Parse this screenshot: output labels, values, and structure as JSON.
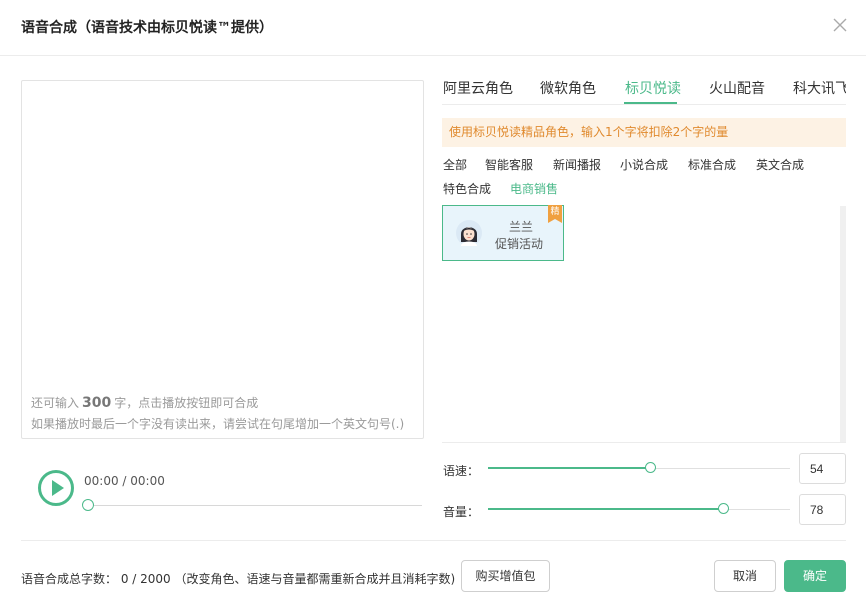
{
  "dialog": {
    "title": "语音合成（语音技术由标贝悦读™提供）",
    "close_icon": "close-icon"
  },
  "editor": {
    "remaining_prefix": "还可输入",
    "remaining_count": "300",
    "remaining_suffix": "字，点击播放按钮即可合成",
    "tip": "如果播放时最后一个字没有读出来，请尝试在句尾增加一个英文句号(.)"
  },
  "player": {
    "play_icon": "play-icon",
    "time": "00:00 / 00:00",
    "progress": 0
  },
  "tabs": [
    {
      "label": "阿里云角色"
    },
    {
      "label": "微软角色"
    },
    {
      "label": "标贝悦读",
      "active": true
    },
    {
      "label": "火山配音"
    },
    {
      "label": "科大讯飞"
    }
  ],
  "notice": "使用标贝悦读精品角色，输入1个字将扣除2个字的量",
  "categories": [
    {
      "label": "全部"
    },
    {
      "label": "智能客服"
    },
    {
      "label": "新闻播报"
    },
    {
      "label": "小说合成"
    },
    {
      "label": "标准合成"
    },
    {
      "label": "英文合成"
    },
    {
      "label": "特色合成"
    },
    {
      "label": "电商销售",
      "active": true
    }
  ],
  "voices": [
    {
      "name": "兰兰",
      "desc": "促销活动",
      "badge": "精",
      "avatar_icon": "female-avatar-icon"
    }
  ],
  "speed": {
    "label": "语速：",
    "value": "54",
    "max": 100
  },
  "volume": {
    "label": "音量：",
    "value": "78",
    "max": 100
  },
  "footer": {
    "total": "语音合成总字数： 0 / 2000 （改变角色、语速与音量都需重新合成并且消耗字数)",
    "buy_label": "购买增值包",
    "cancel_label": "取消",
    "ok_label": "确定"
  },
  "colors": {
    "accent": "#4bb98a",
    "notice_bg": "#fdf2e4",
    "notice_text": "#e08a2e",
    "badge": "#f0a040"
  }
}
